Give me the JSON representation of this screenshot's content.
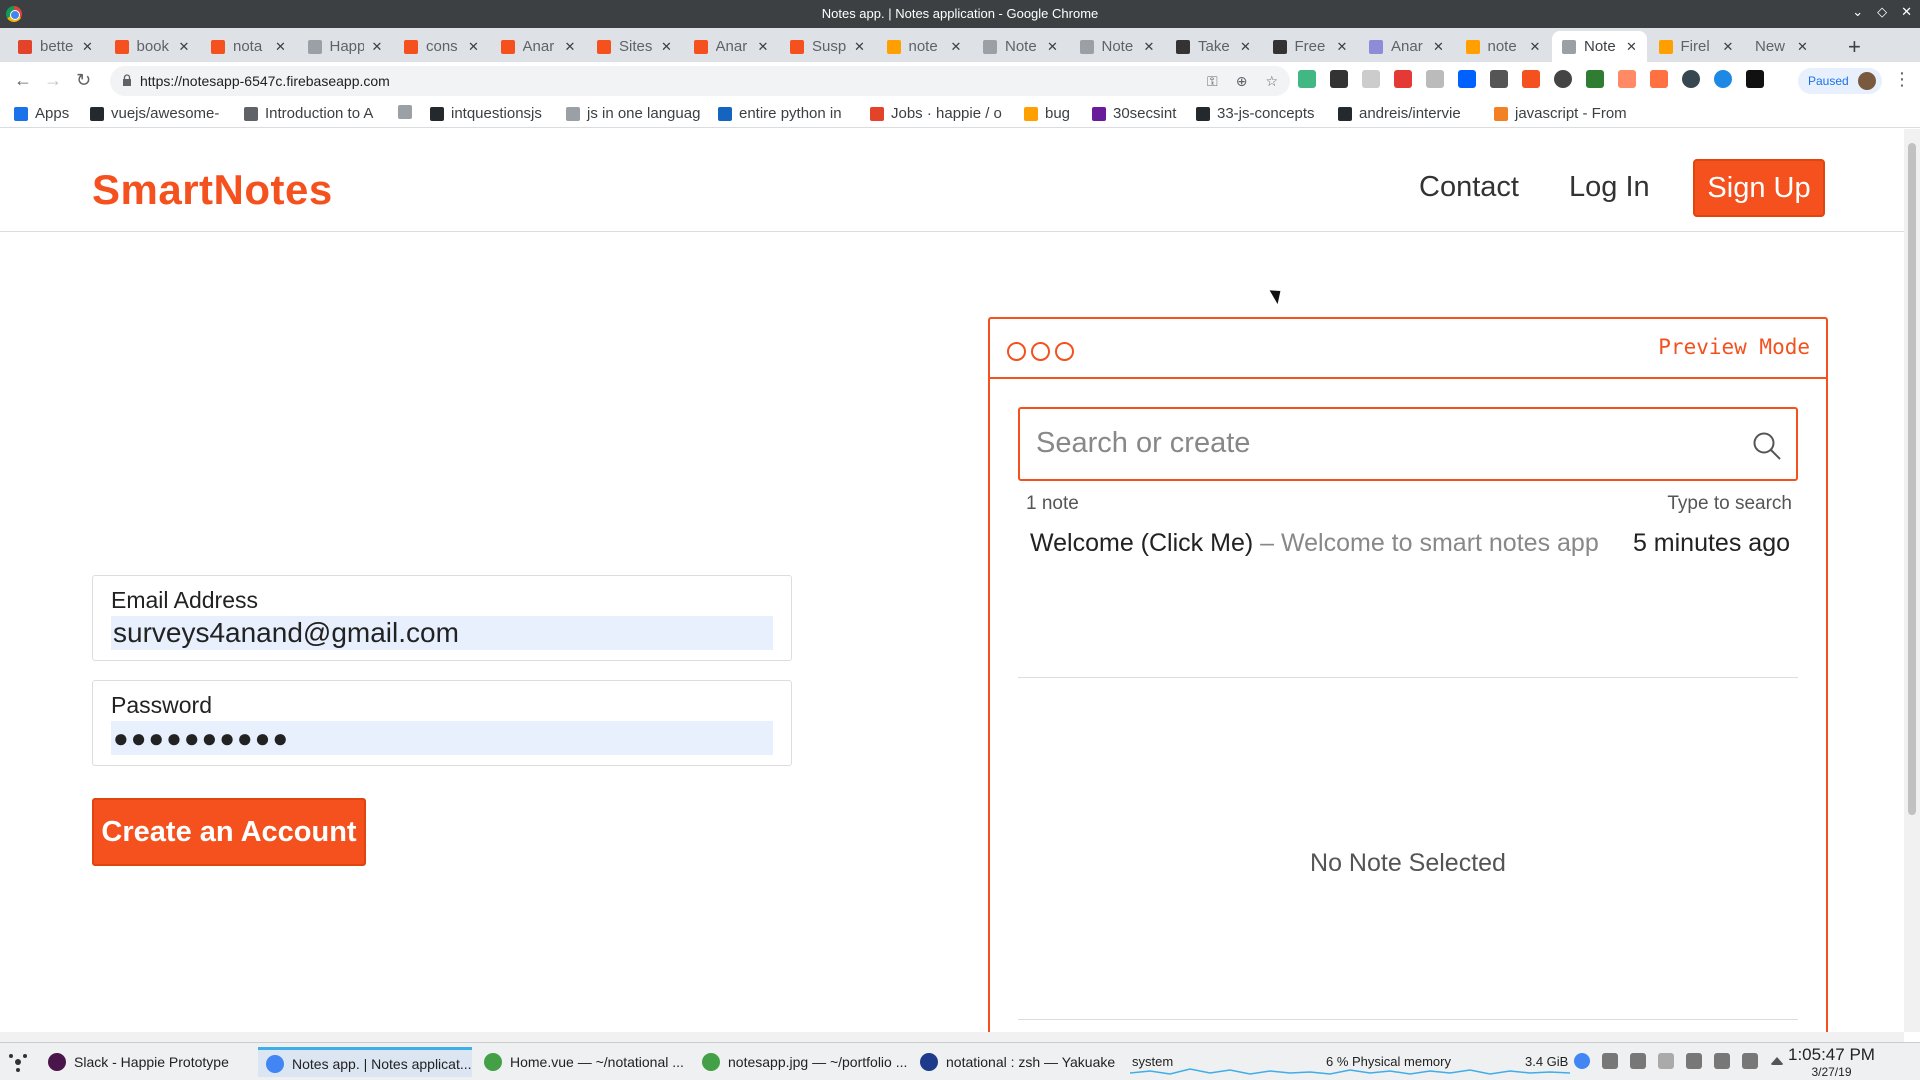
{
  "window": {
    "title": "Notes app. | Notes application - Google Chrome"
  },
  "tabs": [
    {
      "label": "bette",
      "icon": "gitlab-icon",
      "color": "#e24329"
    },
    {
      "label": "book",
      "icon": "app-icon",
      "color": "#f4511e"
    },
    {
      "label": "nota",
      "icon": "app-icon",
      "color": "#f4511e"
    },
    {
      "label": "Happ",
      "icon": "page-icon",
      "color": "#9aa0a6"
    },
    {
      "label": "cons",
      "icon": "app-icon",
      "color": "#f4511e"
    },
    {
      "label": "Anar",
      "icon": "app-icon",
      "color": "#f4511e"
    },
    {
      "label": "Sites",
      "icon": "app-icon",
      "color": "#f4511e"
    },
    {
      "label": "Anar",
      "icon": "app-icon",
      "color": "#f4511e"
    },
    {
      "label": "Susp",
      "icon": "app-icon",
      "color": "#f4511e"
    },
    {
      "label": "note",
      "icon": "firebase-icon",
      "color": "#ffa000"
    },
    {
      "label": "Note",
      "icon": "page-icon",
      "color": "#9aa0a6"
    },
    {
      "label": "Note",
      "icon": "page-icon",
      "color": "#9aa0a6"
    },
    {
      "label": "Take",
      "icon": "dev-icon",
      "color": "#333333"
    },
    {
      "label": "Free",
      "icon": "dev-icon",
      "color": "#333333"
    },
    {
      "label": "Anar",
      "icon": "avatar-icon",
      "color": "#8e8cd8"
    },
    {
      "label": "note",
      "icon": "firebase-icon",
      "color": "#ffa000"
    },
    {
      "label": "Note",
      "icon": "page-icon",
      "color": "#9aa0a6",
      "active": true
    },
    {
      "label": "Firel",
      "icon": "firebase-icon",
      "color": "#ffa000"
    },
    {
      "label": "New Tal",
      "icon": "",
      "color": ""
    }
  ],
  "omnibox": {
    "url": "https://notesapp-6547c.firebaseapp.com"
  },
  "profile": {
    "status": "Paused"
  },
  "bookmarks": [
    {
      "label": "Apps",
      "color": "#1a73e8"
    },
    {
      "label": "vuejs/awesome-",
      "color": "#24292e"
    },
    {
      "label": "Introduction to A",
      "color": "#5f6368"
    },
    {
      "label": "",
      "color": "#9aa0a6"
    },
    {
      "label": "intquestionsjs",
      "color": "#24292e"
    },
    {
      "label": "js in one languag",
      "color": "#9aa0a6"
    },
    {
      "label": "entire python in",
      "color": "#1565c0"
    },
    {
      "label": "Jobs · happie / o",
      "color": "#e24329"
    },
    {
      "label": "bug",
      "color": "#ffa000"
    },
    {
      "label": "30secsint",
      "color": "#6a1b9a"
    },
    {
      "label": "33-js-concepts",
      "color": "#24292e"
    },
    {
      "label": "andreis/intervie",
      "color": "#24292e"
    },
    {
      "label": "javascript - From",
      "color": "#f48024"
    }
  ],
  "app": {
    "brand": "SmartNotes",
    "nav": {
      "contact": "Contact",
      "login": "Log In",
      "signup": "Sign Up"
    },
    "form": {
      "email_label": "Email Address",
      "email_value": "surveys4anand@gmail.com",
      "password_label": "Password",
      "password_value": "●●●●●●●●●●",
      "submit": "Create an Account"
    },
    "preview": {
      "mode_label": "Preview Mode",
      "search_placeholder": "Search or create",
      "note_count": "1 note",
      "search_hint": "Type to search",
      "note": {
        "title": "Welcome (Click Me)",
        "separator": "–",
        "preview": "Welcome to smart notes app",
        "time": "5 minutes ago"
      },
      "empty": "No Note Selected"
    },
    "accent": "#f4511e"
  },
  "taskbar": {
    "items": [
      {
        "label": "Slack - Happie Prototype",
        "color": "#4a154b"
      },
      {
        "label": "Notes app. | Notes applicat...",
        "color": "#4285f4",
        "active": true
      },
      {
        "label": "Home.vue — ~/notational ...",
        "color": "#43a047"
      },
      {
        "label": "notesapp.jpg — ~/portfolio ...",
        "color": "#43a047"
      },
      {
        "label": "notational : zsh — Yakuake",
        "color": "#1e3a8a"
      }
    ],
    "system_label": "system",
    "memory_label": "6 % Physical memory",
    "memory_value": "3.4 GiB",
    "time": "1:05:47 PM",
    "date": "3/27/19"
  }
}
